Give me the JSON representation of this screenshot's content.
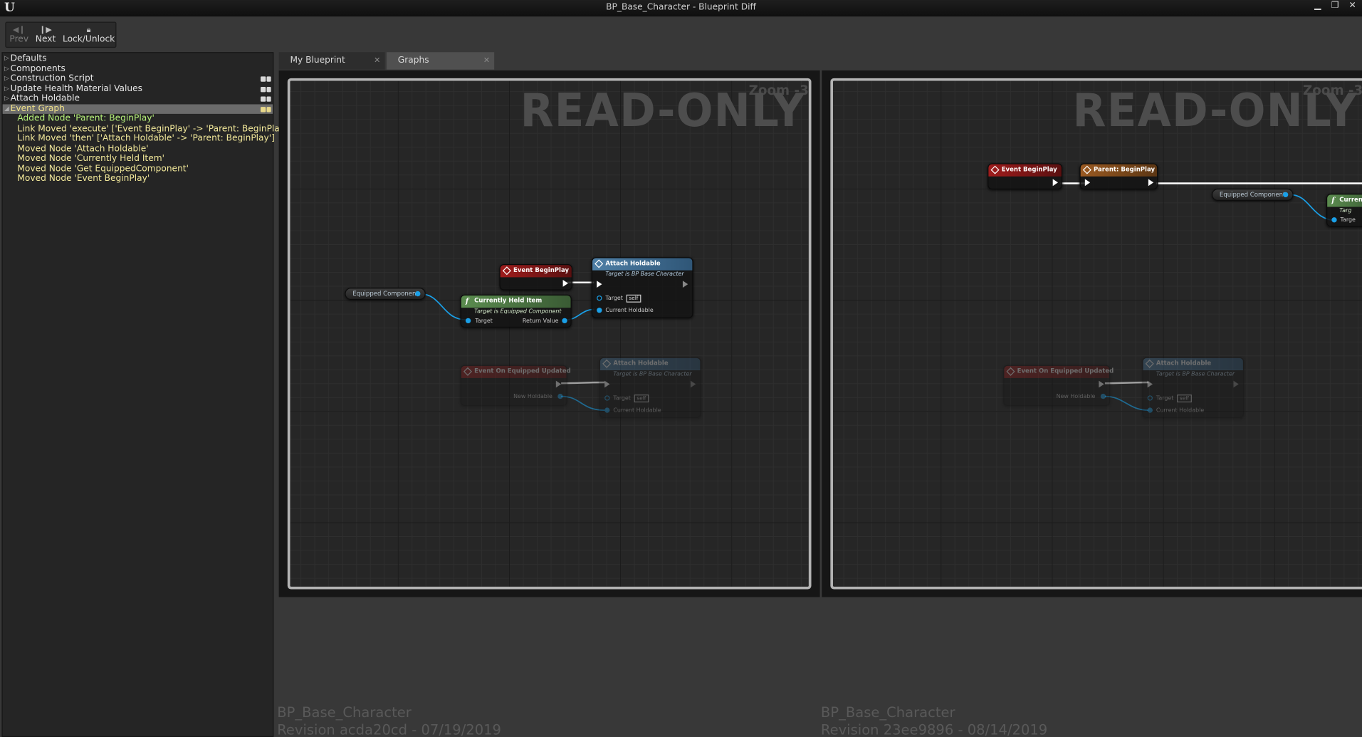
{
  "window": {
    "title": "BP_Base_Character - Blueprint Diff",
    "controls": [
      "minimize",
      "restore",
      "close"
    ]
  },
  "toolbar": {
    "prev_label": "Prev",
    "next_label": "Next",
    "lock_label": "Lock/Unlock"
  },
  "tree": {
    "items": [
      {
        "label": "Defaults",
        "badge": false
      },
      {
        "label": "Components",
        "badge": false
      },
      {
        "label": "Construction Script",
        "badge": true
      },
      {
        "label": "Update Health Material Values",
        "badge": true
      },
      {
        "label": "Attach Holdable",
        "badge": true
      },
      {
        "label": "Event Graph",
        "badge": true,
        "selected": true
      }
    ],
    "changes": [
      {
        "text": "Added Node 'Parent: BeginPlay'",
        "kind": "added"
      },
      {
        "text": "Link Moved  'execute' ['Event BeginPlay' -> 'Parent: BeginPlay']",
        "kind": "moved"
      },
      {
        "text": "Link Moved  'then' ['Attach Holdable' -> 'Parent: BeginPlay']",
        "kind": "moved"
      },
      {
        "text": "Moved Node 'Attach Holdable'",
        "kind": "moved"
      },
      {
        "text": "Moved Node 'Currently Held Item'",
        "kind": "moved"
      },
      {
        "text": "Moved Node 'Get EquippedComponent'",
        "kind": "moved"
      },
      {
        "text": "Moved Node 'Event BeginPlay'",
        "kind": "moved"
      }
    ]
  },
  "tabs": [
    {
      "label": "My Blueprint"
    },
    {
      "label": "Graphs"
    }
  ],
  "graph_overlay": {
    "readonly": "READ-ONLY",
    "zoom_left": "Zoom -3",
    "zoom_right": "Zoom -3"
  },
  "left_graph": {
    "event_beginplay": "Event BeginPlay",
    "attach_holdable": "Attach Holdable",
    "attach_holdable_sub": "Target is BP Base Character",
    "target_pin": "Target",
    "self_label": "self",
    "current_holdable_pin": "Current Holdable",
    "equipped_component": "Equipped Component",
    "currently_held_item": "Currently Held Item",
    "currently_held_item_sub": "Target is Equipped Component",
    "return_value_pin": "Return Value",
    "event_on_equipped_updated": "Event On Equipped Updated",
    "new_holdable_pin": "New Holdable"
  },
  "right_graph": {
    "event_beginplay": "Event BeginPlay",
    "parent_beginplay": "Parent: BeginPlay",
    "equipped_component": "Equipped Component",
    "currently_partial": "Current",
    "target_partial_top": "Targ",
    "target_partial": "Targe",
    "attach_holdable": "Attach Holdable",
    "attach_holdable_sub": "Target is BP Base Character",
    "target_pin": "Target",
    "self_label": "self",
    "current_holdable_pin": "Current Holdable",
    "event_on_equipped_updated": "Event On Equipped Updated",
    "new_holdable_pin": "New Holdable"
  },
  "revisions": {
    "left_name": "BP_Base_Character",
    "left_revision": "Revision acda20cd - 07/19/2019",
    "right_name": "BP_Base_Character",
    "right_revision": "Revision 23ee9896 - 08/14/2019"
  },
  "colors": {
    "event_node": "#9e1c1c",
    "parent_node": "#9a5a22",
    "function_node_blue": "#4e7fa6",
    "pure_function_green": "#5b8c4f",
    "object_pin": "#1aa0e8",
    "added_change": "#b7f27a",
    "moved_change": "#f2e89a"
  }
}
